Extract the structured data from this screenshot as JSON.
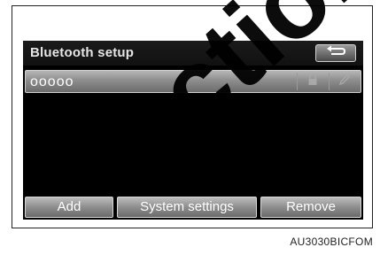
{
  "screen": {
    "title": "Bluetooth setup",
    "back_icon": "return-arrow-icon",
    "device": {
      "name": "ooooo",
      "icons": [
        "lock-icon",
        "pencil-icon"
      ]
    },
    "buttons": {
      "add": "Add",
      "system_settings": "System settings",
      "remove": "Remove"
    }
  },
  "figure": {
    "code": "AU3030BICFOM",
    "watermark": "ction"
  }
}
